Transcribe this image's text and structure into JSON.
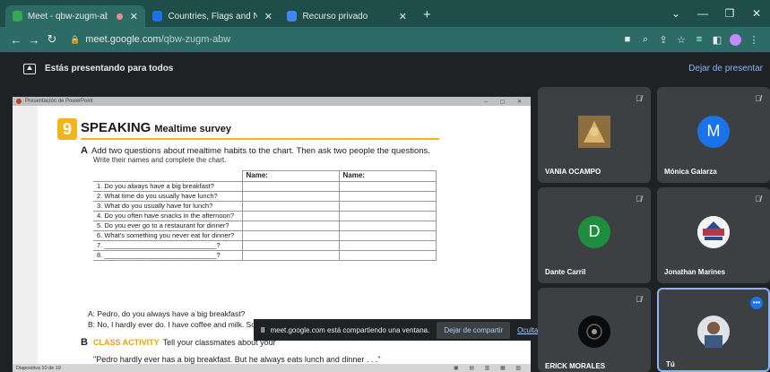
{
  "browser": {
    "tabs": [
      {
        "title": "Meet - qbw-zugm-abw",
        "icon_color": "#34a853",
        "recording": true,
        "active": true
      },
      {
        "title": "Countries, Flags and Nationalitie",
        "icon_color": "#1a73e8",
        "active": false
      },
      {
        "title": "Recurso privado",
        "icon_color": "#4285f4",
        "active": false
      }
    ],
    "new_tab": "+",
    "url_host": "meet.google.com",
    "url_path": "/qbw-zugm-abw"
  },
  "meet": {
    "presenting_text": "Estás presentando para todos",
    "stop_presenting": "Dejar de presentar",
    "share_bar": {
      "message": "meet.google.com está compartiendo una ventana.",
      "stop_sharing": "Dejar de compartir",
      "hide": "Ocultar"
    },
    "participants": [
      {
        "name": "VANIA OCAMPO",
        "avatar": "photo",
        "color": "#8d6e3f"
      },
      {
        "name": "Mónica Galarza",
        "avatar": "M",
        "color": "#1a73e8"
      },
      {
        "name": "Dante Carril",
        "avatar": "D",
        "color": "#1e8e3e"
      },
      {
        "name": "Jonathan Marines",
        "avatar": "photo",
        "color": "#b03a48"
      },
      {
        "name": "ERICK MORALES",
        "avatar": "photo",
        "color": "#111111"
      },
      {
        "name": "Tú",
        "avatar": "photo",
        "color": "#6b7b8c"
      }
    ]
  },
  "slide": {
    "unit_number": "9",
    "title": "SPEAKING",
    "subtitle": "Mealtime survey",
    "instruction_letter": "A",
    "instruction": "Add two questions about mealtime habits to the chart. Then ask two people the questions.",
    "instruction2": "Write their names and complete the chart.",
    "col_name1": "Name:",
    "col_name2": "Name:",
    "questions": [
      "1.  Do you always have a big breakfast?",
      "2.  What time do you usually have lunch?",
      "3.  What do you usually have for lunch?",
      "4.  Do you often have snacks in the afternoon?",
      "5.  Do you ever go to a restaurant for dinner?",
      "6.  What's something you never eat for dinner?",
      "7.  ______________________________?",
      "8.  ______________________________?"
    ],
    "dialog_a": "A: Pedro, do you always have a big breakfast?",
    "dialog_b": "B: No, I hardly ever do. I have coffee and milk. Sometimes I eat bread or crackers.",
    "section_b_letter": "B",
    "class_activity": "CLASS ACTIVITY",
    "class_activity_text": "Tell your classmates about your",
    "quote": "\"Pedro hardly ever has a big breakfast. But he always eats lunch and dinner . . .\""
  }
}
